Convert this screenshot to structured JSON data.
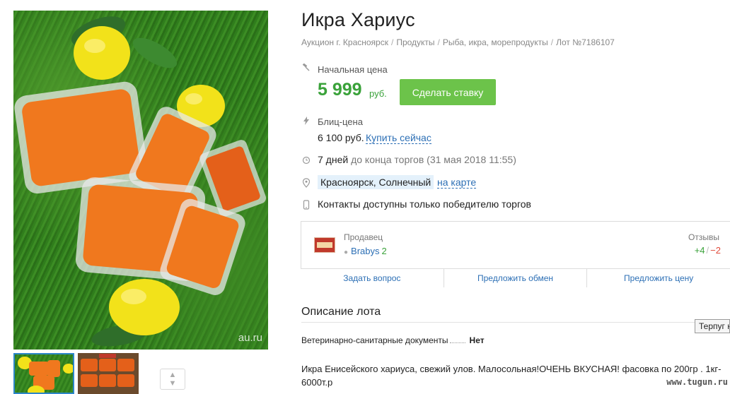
{
  "lot": {
    "title": "Икра Хариус",
    "breadcrumb": [
      "Аукцион г. Красноярск",
      "Продукты",
      "Рыба, икра, морепродукты",
      "Лот №7186107"
    ]
  },
  "photo": {
    "watermark": "au.ru"
  },
  "pricing": {
    "start_label": "Начальная цена",
    "start_price": "5 999",
    "currency": "руб.",
    "bid_button": "Сделать ставку",
    "blitz_label": "Блиц-цена",
    "blitz_price": "6 100 руб.",
    "buy_now": "Купить сейчас"
  },
  "timing": {
    "days": "7 дней",
    "until": "до конца торгов",
    "end_date": "(31 мая 2018 11:55)"
  },
  "location": {
    "city": "Красноярск, Солнечный",
    "map_link": "на карте"
  },
  "contacts": "Контакты доступны только победителю торгов",
  "seller": {
    "label": "Продавец",
    "name": "Brabys",
    "count": "2",
    "reviews_label": "Отзывы",
    "reviews_pos": "+4",
    "reviews_sep": "/",
    "reviews_neg": "−2",
    "actions": [
      "Задать вопрос",
      "Предложить обмен",
      "Предложить цену"
    ]
  },
  "description": {
    "title": "Описание лота",
    "vet_label": "Ветеринарно-санитарные документы",
    "vet_value": "Нет",
    "text": "Икра Енисейского хариуса, свежий улов. Малосольная!ОЧЕНЬ ВКУСНАЯ! фасовка по 200гр . 1кг- 6000т.р"
  },
  "tooltip": "Терпуг н",
  "site_watermark": "www.tugun.ru",
  "colors": {
    "price_green": "#3aa23a",
    "button_green": "#6cc34a",
    "link_blue": "#2c6fb5",
    "city_highlight": "#e4f1fb",
    "negative_red": "#e04a3a"
  },
  "icons": {
    "start_price": "gavel-icon",
    "blitz": "lightning-icon",
    "time": "clock-icon",
    "location": "location-pin-icon",
    "contacts": "phone-icon"
  }
}
